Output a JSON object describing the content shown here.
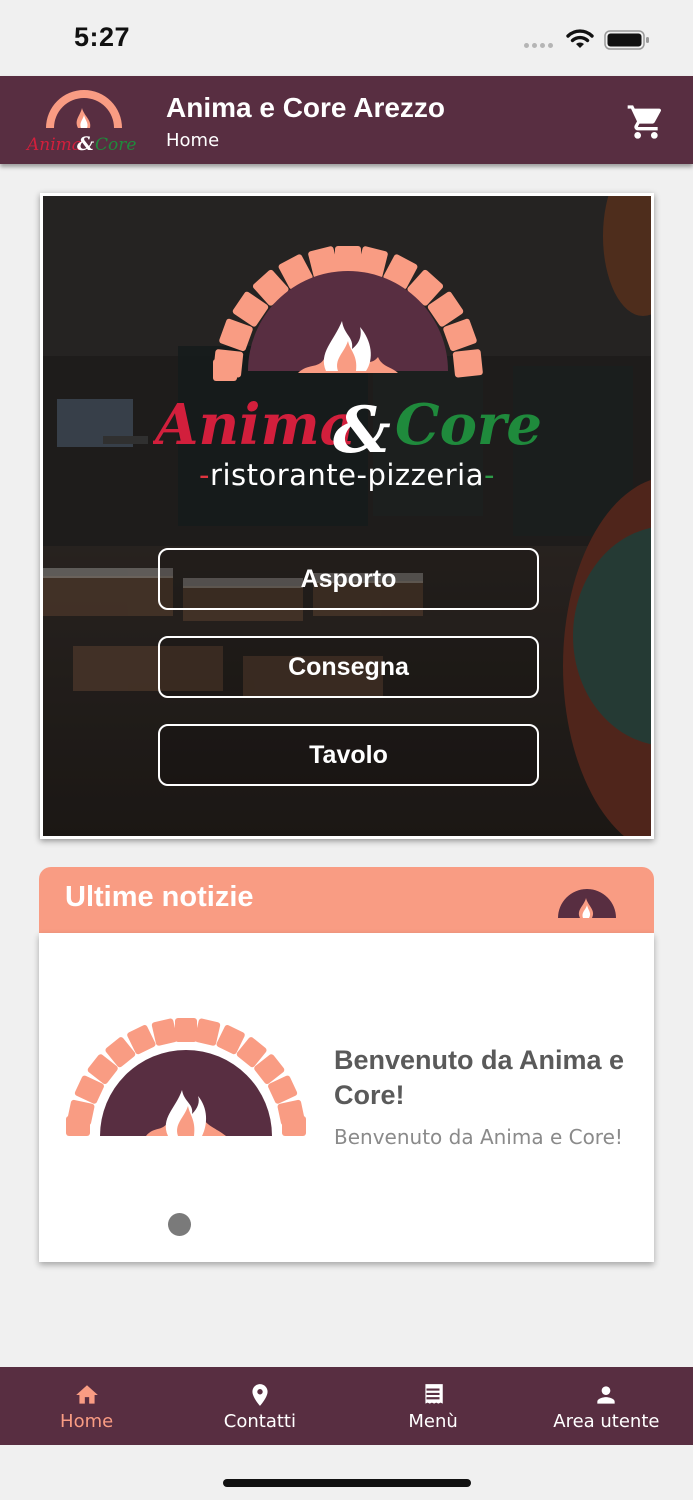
{
  "status_bar": {
    "time": "5:27"
  },
  "header": {
    "title": "Anima e Core Arezzo",
    "subtitle": "Home",
    "logo_text": "Anima & Core",
    "cart_icon": "cart-icon"
  },
  "hero": {
    "logo_text": "Anima & Core",
    "tagline_dash_left": "-",
    "tagline": "ristorante-pizzeria",
    "tagline_dash_right": "-",
    "buttons": {
      "takeaway": "Asporto",
      "delivery": "Consegna",
      "table": "Tavolo"
    }
  },
  "news": {
    "title": "Ultime notizie",
    "items": [
      {
        "headline": "Benvenuto da Anima e Core!",
        "text": "Benvenuto da Anima e Core!"
      }
    ]
  },
  "nav": {
    "items": [
      {
        "label": "Home",
        "icon": "home-icon",
        "active": true
      },
      {
        "label": "Contatti",
        "icon": "location-pin-icon",
        "active": false
      },
      {
        "label": "Menù",
        "icon": "menu-list-icon",
        "active": false
      },
      {
        "label": "Area utente",
        "icon": "user-icon",
        "active": false
      }
    ]
  },
  "colors": {
    "brand_plum": "#582e41",
    "accent_salmon": "#f99c83",
    "logo_red": "#d21f3c",
    "logo_green": "#1f8a3c",
    "background": "#f0f0f0"
  }
}
